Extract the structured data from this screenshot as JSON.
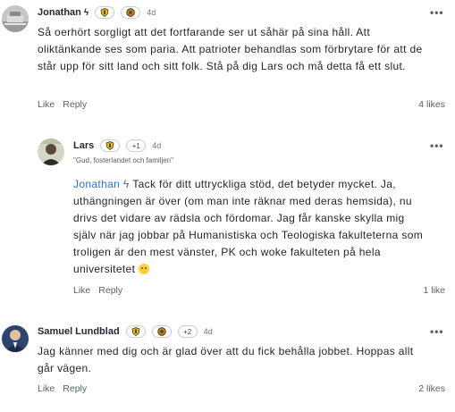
{
  "comments": [
    {
      "author": "Jonathan",
      "author_bolt": "ϟ",
      "badge_extra": "",
      "time": "4d",
      "menu": "•••",
      "subtitle": "",
      "body": "Så oerhört sorgligt att det fortfarande ser ut såhär på sina håll. Att oliktänkande ses som paria.  Att patrioter behandlas som förbrytare för att de står upp för sitt land och sitt folk. Stå på dig Lars och må detta få ett slut.",
      "like_label": "Like",
      "reply_label": "Reply",
      "likes": "4 likes"
    },
    {
      "author": "Lars",
      "badge_extra": "+1",
      "time": "4d",
      "menu": "•••",
      "subtitle": "\"Gud, fosterlandet och familjen\"",
      "mention": "Jonathan ϟ",
      "body": " Tack för ditt uttryckliga stöd, det betyder mycket. Ja, uthängningen är över (om man inte räknar med deras hemsida), nu drivs det vidare av rädsla och fördomar. Jag får kanske skylla mig själv när jag jobbar på Humanistiska och Teologiska fakulteterna som troligen är den mest vänster, PK och woke fakulteten på hela universitetet ",
      "like_label": "Like",
      "reply_label": "Reply",
      "likes": "1 like"
    },
    {
      "author": "Samuel Lundblad",
      "badge_extra": "+2",
      "time": "4d",
      "menu": "•••",
      "subtitle": "",
      "body": "Jag känner med dig och är glad över att du fick behålla jobbet. Hoppas allt går vägen.",
      "like_label": "Like",
      "reply_label": "Reply",
      "likes": "2 likes"
    }
  ],
  "colors": {
    "mention": "#2f6fd6",
    "text": "#1f2328",
    "muted": "#57606a",
    "badge_gold": "#e8b923"
  },
  "icons": [
    "avatar",
    "shield-badge-icon",
    "bronze-medal-icon",
    "more-options-icon",
    "smiley-emoji-icon"
  ]
}
